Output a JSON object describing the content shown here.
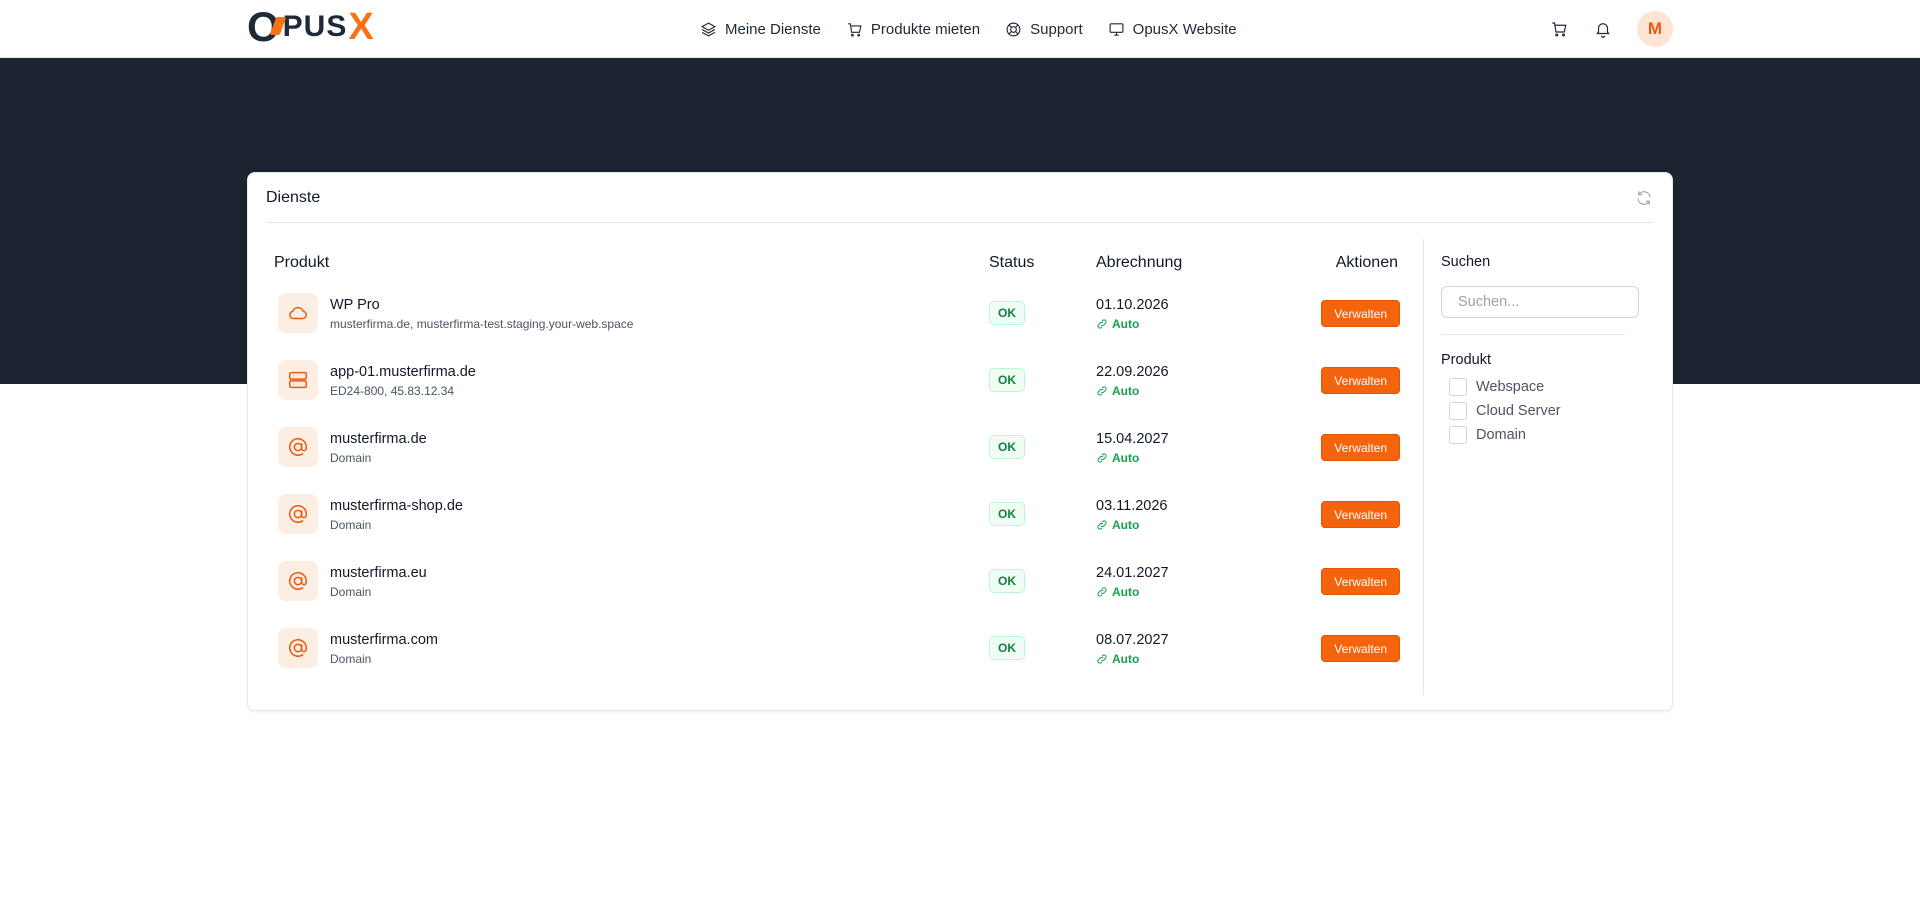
{
  "brand": {
    "logo_o": "O",
    "logo_pus": "PUS",
    "logo_x": "X"
  },
  "nav": [
    {
      "label": "Meine Dienste",
      "icon": "layers-icon"
    },
    {
      "label": "Produkte mieten",
      "icon": "cart-icon"
    },
    {
      "label": "Support",
      "icon": "lifebuoy-icon"
    },
    {
      "label": "OpusX Website",
      "icon": "monitor-icon"
    }
  ],
  "user": {
    "avatar_initial": "M"
  },
  "colors": {
    "accent": "#f4640c",
    "band": "#1c2331",
    "ok": "#15803d"
  },
  "card": {
    "title": "Dienste",
    "columns": {
      "product": "Produkt",
      "status": "Status",
      "billing": "Abrechnung",
      "actions": "Aktionen"
    },
    "rows": [
      {
        "name": "WP Pro",
        "sub": "musterfirma.de, musterfirma-test.staging.your-web.space",
        "icon": "cloud-icon",
        "status": "OK",
        "date": "01.10.2026",
        "billing": "Auto",
        "action": "Verwalten"
      },
      {
        "name": "app-01.musterfirma.de",
        "sub": "ED24-800, 45.83.12.34",
        "icon": "server-icon",
        "status": "OK",
        "date": "22.09.2026",
        "billing": "Auto",
        "action": "Verwalten"
      },
      {
        "name": "musterfirma.de",
        "sub": "Domain",
        "icon": "at-icon",
        "status": "OK",
        "date": "15.04.2027",
        "billing": "Auto",
        "action": "Verwalten"
      },
      {
        "name": "musterfirma-shop.de",
        "sub": "Domain",
        "icon": "at-icon",
        "status": "OK",
        "date": "03.11.2026",
        "billing": "Auto",
        "action": "Verwalten"
      },
      {
        "name": "musterfirma.eu",
        "sub": "Domain",
        "icon": "at-icon",
        "status": "OK",
        "date": "24.01.2027",
        "billing": "Auto",
        "action": "Verwalten"
      },
      {
        "name": "musterfirma.com",
        "sub": "Domain",
        "icon": "at-icon",
        "status": "OK",
        "date": "08.07.2027",
        "billing": "Auto",
        "action": "Verwalten"
      }
    ]
  },
  "sidebar": {
    "search_label": "Suchen",
    "search_placeholder": "Suchen...",
    "search_value": "",
    "filter_label": "Produkt",
    "filters": [
      {
        "label": "Webspace",
        "checked": false
      },
      {
        "label": "Cloud Server",
        "checked": false
      },
      {
        "label": "Domain",
        "checked": false
      }
    ]
  }
}
